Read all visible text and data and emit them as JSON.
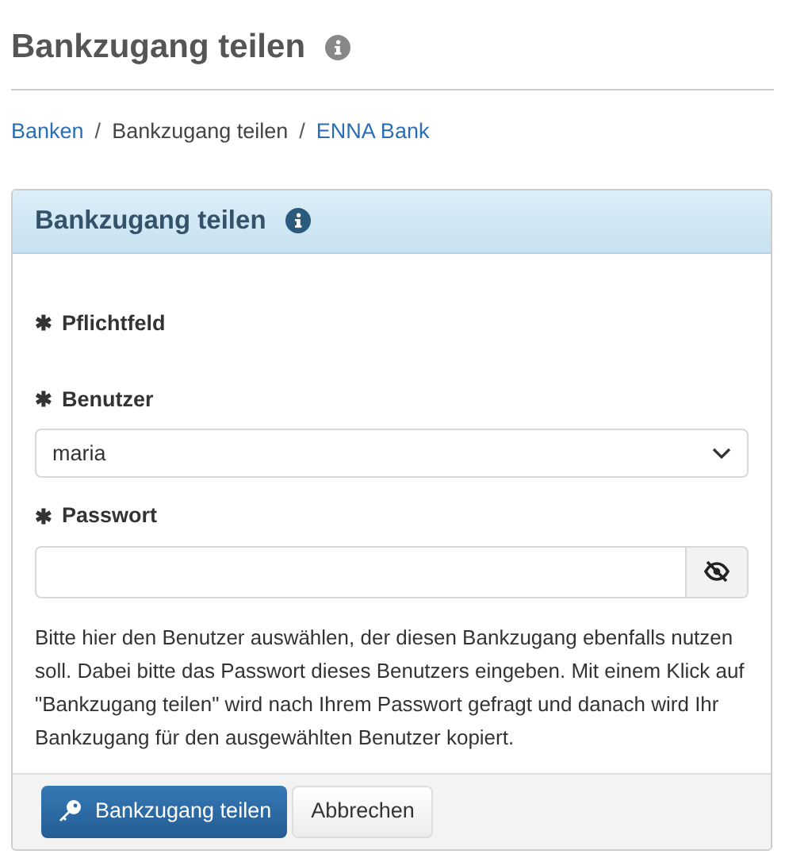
{
  "page_title": "Bankzugang teilen",
  "breadcrumb": [
    {
      "label": "Banken",
      "kind": "link"
    },
    {
      "label": "Bankzugang teilen",
      "kind": "text"
    },
    {
      "label": "ENNA Bank",
      "kind": "link"
    }
  ],
  "breadcrumb_separator": "/",
  "panel": {
    "title": "Bankzugang teilen",
    "required_note": {
      "mark": "✱",
      "label": "Pflichtfeld"
    },
    "fields": [
      {
        "kind": "select",
        "mark": "✱",
        "label": "Benutzer",
        "value": "maria"
      },
      {
        "kind": "password",
        "mark": "✱",
        "label": "Passwort"
      }
    ],
    "help_text": "Bitte hier den Benutzer auswählen, der diesen Bankzugang ebenfalls nutzen soll. Dabei bitte das Passwort dieses Benutzers eingeben. Mit einem Klick auf \"Bankzugang teilen\" wird nach Ihrem Passwort gefragt und danach wird Ihr Bankzugang für den ausgewählten Benutzer kopiert.",
    "buttons": [
      {
        "label": "Bankzugang teilen",
        "kind": "primary"
      },
      {
        "label": "Abbrechen",
        "kind": "default"
      }
    ]
  }
}
